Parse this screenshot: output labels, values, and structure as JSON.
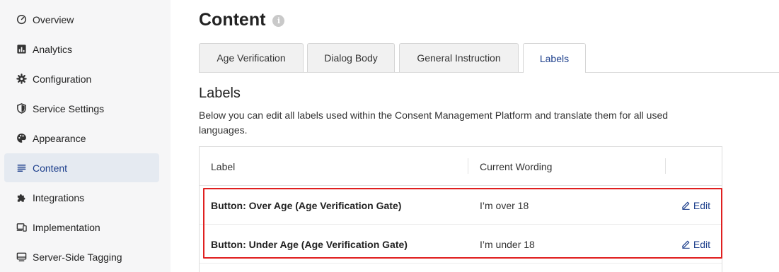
{
  "sidebar": {
    "items": [
      {
        "label": "Overview",
        "icon": "speedometer-icon",
        "active": false
      },
      {
        "label": "Analytics",
        "icon": "bar-chart-icon",
        "active": false
      },
      {
        "label": "Configuration",
        "icon": "gear-icon",
        "active": false
      },
      {
        "label": "Service Settings",
        "icon": "shield-icon",
        "active": false
      },
      {
        "label": "Appearance",
        "icon": "palette-icon",
        "active": false
      },
      {
        "label": "Content",
        "icon": "lines-icon",
        "active": true
      },
      {
        "label": "Integrations",
        "icon": "puzzle-icon",
        "active": false
      },
      {
        "label": "Implementation",
        "icon": "devices-icon",
        "active": false
      },
      {
        "label": "Server-Side Tagging",
        "icon": "server-icon",
        "active": false
      }
    ]
  },
  "header": {
    "title": "Content",
    "info_glyph": "i"
  },
  "tabs": [
    {
      "label": "Age Verification",
      "active": false
    },
    {
      "label": "Dialog Body",
      "active": false
    },
    {
      "label": "General Instruction",
      "active": false
    },
    {
      "label": "Labels",
      "active": true
    }
  ],
  "section": {
    "title": "Labels",
    "description": "Below you can edit all labels used within the Consent Management Platform and translate them for all used languages."
  },
  "table": {
    "columns": [
      "Label",
      "Current Wording",
      ""
    ],
    "rows": [
      {
        "label": "Button: Over Age (Age Verification Gate)",
        "wording": "I’m over 18",
        "action": "Edit"
      },
      {
        "label": "Button: Under Age (Age Verification Gate)",
        "wording": "I’m under 18",
        "action": "Edit"
      }
    ]
  },
  "colors": {
    "accent": "#1d3f8c",
    "active_nav_bg": "#e5eaf1",
    "highlight_border": "#e02020",
    "sidebar_bg": "#f6f6f7"
  }
}
